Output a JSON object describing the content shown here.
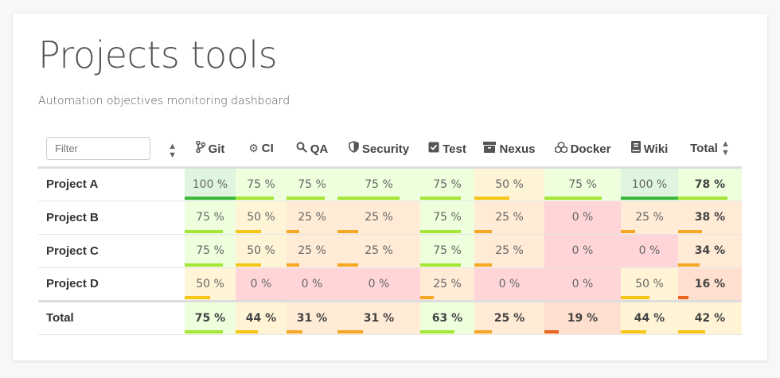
{
  "page": {
    "title": "Projects tools",
    "subtitle": "Automation objectives monitoring dashboard"
  },
  "filter": {
    "placeholder": "Filter"
  },
  "columns": [
    {
      "key": "git",
      "label": "Git",
      "icon": "git-branch-icon"
    },
    {
      "key": "ci",
      "label": "CI",
      "icon": "gear-icon"
    },
    {
      "key": "qa",
      "label": "QA",
      "icon": "search-icon"
    },
    {
      "key": "security",
      "label": "Security",
      "icon": "shield-icon"
    },
    {
      "key": "test",
      "label": "Test",
      "icon": "checkbox-icon"
    },
    {
      "key": "nexus",
      "label": "Nexus",
      "icon": "archive-icon"
    },
    {
      "key": "docker",
      "label": "Docker",
      "icon": "cubes-icon"
    },
    {
      "key": "wiki",
      "label": "Wiki",
      "icon": "book-icon"
    },
    {
      "key": "total",
      "label": "Total",
      "icon": "sort-icon"
    }
  ],
  "rows": [
    {
      "name": "Project A",
      "values": [
        100,
        75,
        75,
        75,
        75,
        50,
        75,
        100,
        78
      ]
    },
    {
      "name": "Project B",
      "values": [
        75,
        50,
        25,
        25,
        75,
        25,
        0,
        25,
        38
      ]
    },
    {
      "name": "Project C",
      "values": [
        75,
        50,
        25,
        25,
        75,
        25,
        0,
        0,
        34
      ]
    },
    {
      "name": "Project D",
      "values": [
        50,
        0,
        0,
        0,
        25,
        0,
        0,
        50,
        16
      ]
    }
  ],
  "total_row": {
    "name": "Total",
    "values": [
      75,
      44,
      31,
      31,
      63,
      25,
      19,
      44,
      42
    ]
  },
  "unit": " %",
  "colors": {
    "bg_100": "#dff5df",
    "bar_100": "#3cb93c",
    "bg_high": "#eeffdd",
    "bar_high": "#a3e635",
    "bg_mid": "#fff5d6",
    "bar_mid": "#f5c518",
    "bg_low": "#ffebd6",
    "bar_low": "#f5a623",
    "bg_vlow": "#ffe0d0",
    "bar_vlow": "#e8641e",
    "bg_zero": "#ffd5d8"
  }
}
